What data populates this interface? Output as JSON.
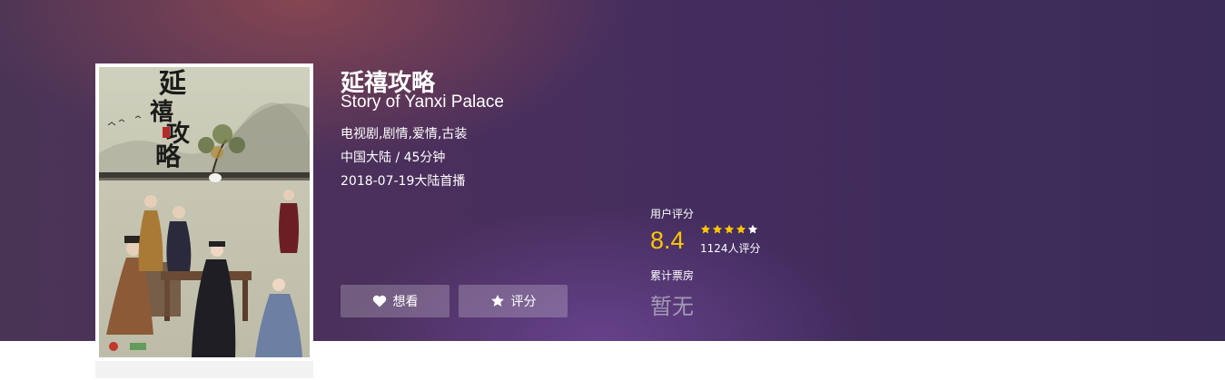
{
  "movie": {
    "title_cn": "延禧攻略",
    "title_en": "Story of Yanxi Palace",
    "genres": "电视剧,剧情,爱情,古装",
    "region_duration": "中国大陆 / 45分钟",
    "release": "2018-07-19大陆首播",
    "poster_title": "延禧攻略"
  },
  "actions": {
    "want_label": "想看",
    "rate_label": "评分"
  },
  "rating": {
    "label": "用户评分",
    "score": "8.4",
    "stars": 4,
    "max_stars": 5,
    "count": "1124人评分"
  },
  "box_office": {
    "label": "累计票房",
    "value": "暂无"
  },
  "colors": {
    "score": "#ffc600",
    "star_on": "#ffc600",
    "star_off": "#ffffff",
    "boxoffice_value": "#a399b5"
  },
  "icons": {
    "want": "heart-icon",
    "rate": "star-icon"
  }
}
